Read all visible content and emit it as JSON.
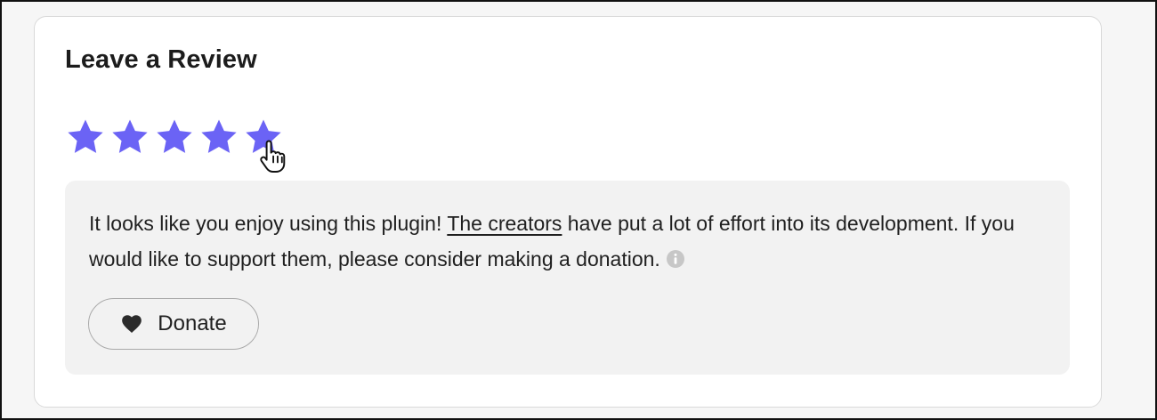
{
  "review": {
    "title": "Leave a Review",
    "rating": 5,
    "max_rating": 5,
    "star_color": "#6b63f5",
    "star_icon": "star-icon",
    "cursor_icon": "pointer-hand-icon"
  },
  "message": {
    "before_link": "It looks like you enjoy using this plugin! ",
    "link_text": "The creators",
    "after_link": " have put a lot of effort into its development. If you would like to support them, please consider making a donation.",
    "info_icon": "info-icon"
  },
  "donate": {
    "label": "Donate",
    "icon": "heart-icon"
  }
}
